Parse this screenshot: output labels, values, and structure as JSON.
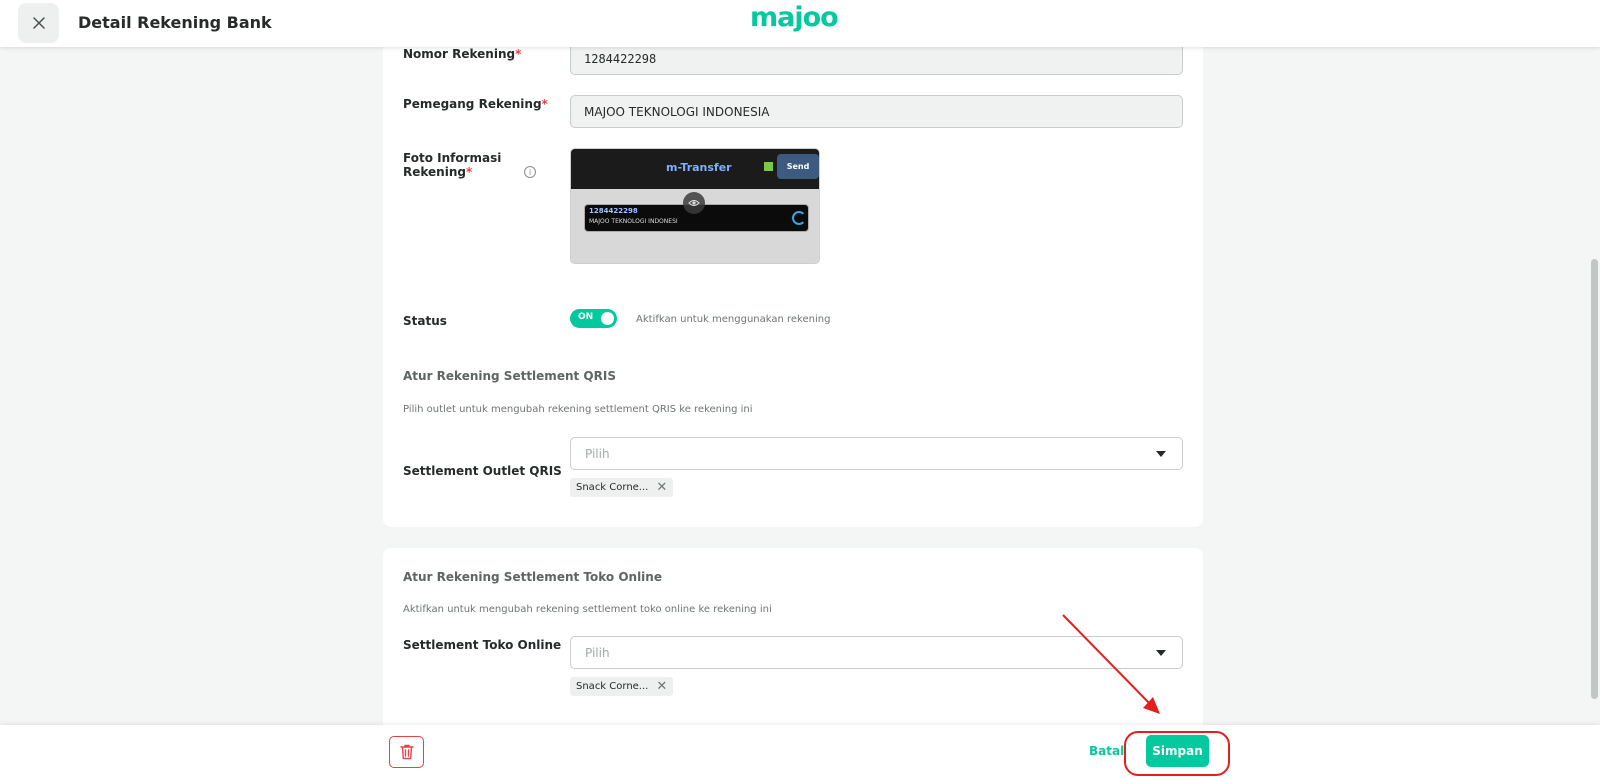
{
  "header": {
    "title": "Detail Rekening Bank",
    "brand": "majoo"
  },
  "account": {
    "number_label": "Nomor Rekening",
    "number_value": "1284422298",
    "holder_label": "Pemegang Rekening",
    "holder_value": "MAJOO TEKNOLOGI INDONESIA",
    "photo_label_line1": "Foto Informasi",
    "photo_label_line2": "Rekening",
    "required_mark": "*",
    "photo": {
      "title": "m-Transfer",
      "send": "Send",
      "acct_number": "1284422298",
      "acct_name": "MAJOO TEKNOLOGI INDONESI"
    },
    "status_label": "Status",
    "status_toggle": "ON",
    "status_desc": "Aktifkan untuk menggunakan rekening"
  },
  "qris": {
    "title": "Atur Rekening Settlement QRIS",
    "desc": "Pilih outlet untuk mengubah rekening settlement QRIS ke rekening ini",
    "field_label": "Settlement Outlet QRIS",
    "placeholder": "Pilih",
    "chip": "Snack Corne..."
  },
  "online": {
    "title": "Atur Rekening Settlement Toko Online",
    "desc": "Aktifkan untuk mengubah rekening settlement toko online ke rekening ini",
    "field_label": "Settlement Toko Online",
    "placeholder": "Pilih",
    "chip": "Snack Corne..."
  },
  "footer": {
    "cancel": "Batal",
    "save": "Simpan"
  },
  "colors": {
    "accent": "#04c99e",
    "danger": "#e34343",
    "annotation": "#e41d1d"
  }
}
